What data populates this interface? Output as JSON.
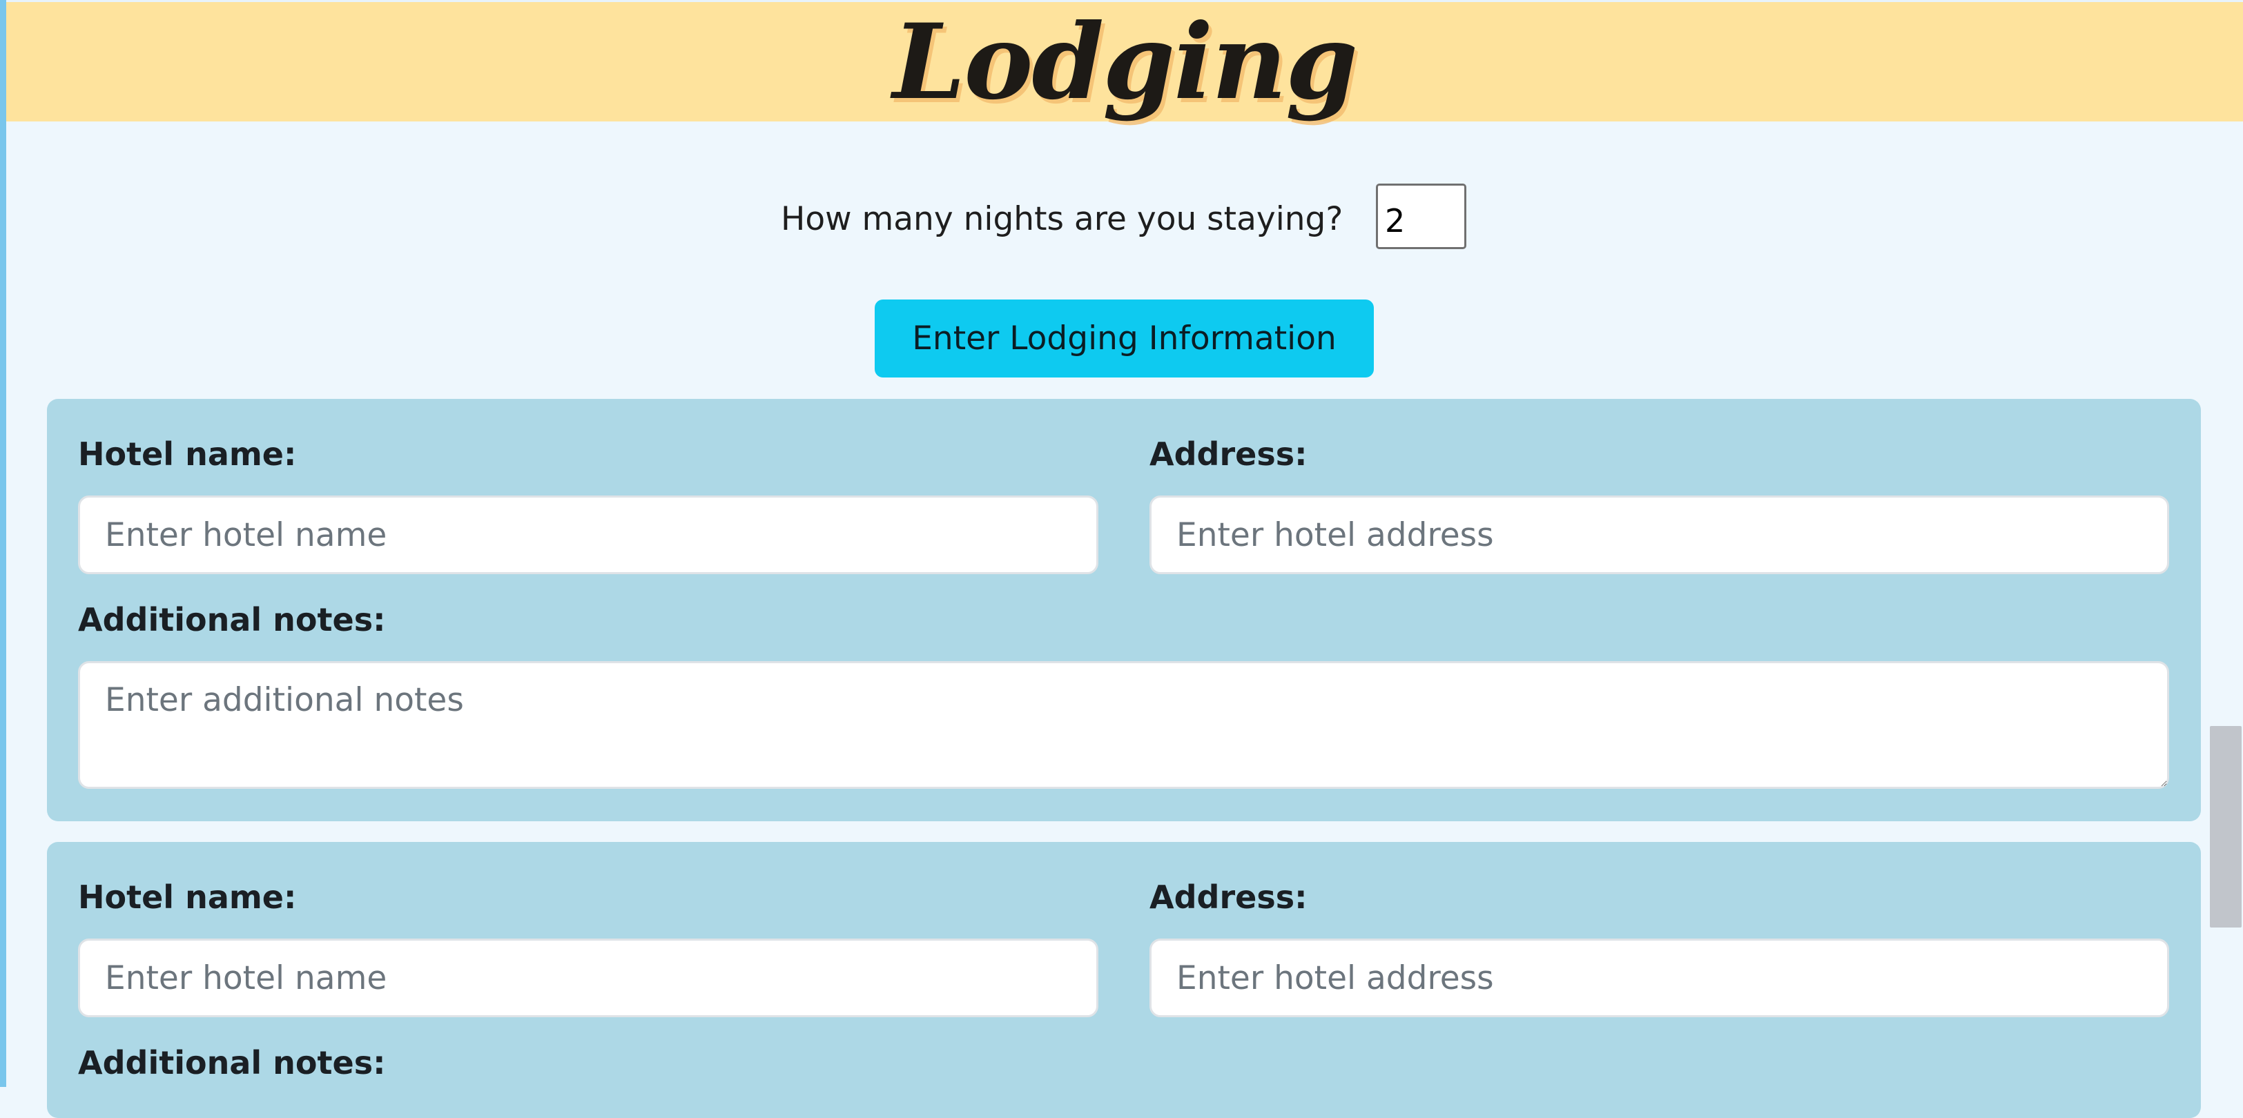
{
  "header": {
    "title": "Lodging"
  },
  "nights": {
    "label": "How many nights are you staying?",
    "value": "2"
  },
  "enter_button": {
    "label": "Enter Lodging Information"
  },
  "lodging_cards": [
    {
      "hotel_name_label": "Hotel name:",
      "hotel_name_placeholder": "Enter hotel name",
      "address_label": "Address:",
      "address_placeholder": "Enter hotel address",
      "notes_label": "Additional notes:",
      "notes_placeholder": "Enter additional notes"
    },
    {
      "hotel_name_label": "Hotel name:",
      "hotel_name_placeholder": "Enter hotel name",
      "address_label": "Address:",
      "address_placeholder": "Enter hotel address",
      "notes_label": "Additional notes:"
    }
  ],
  "colors": {
    "header_bg": "#fee39d",
    "page_bg": "#eef7fd",
    "button_bg": "#0ecaf0",
    "card_bg": "#add8e6"
  }
}
